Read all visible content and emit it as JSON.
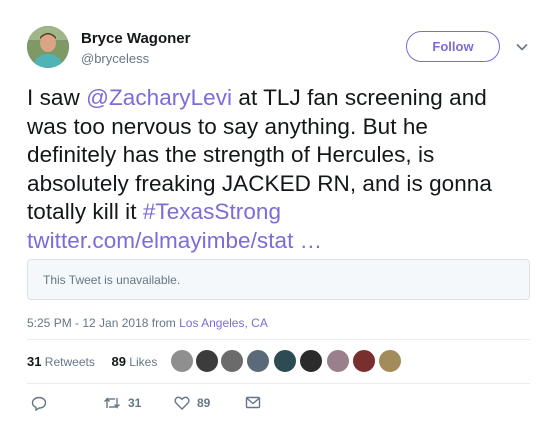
{
  "author": {
    "name": "Bryce Wagoner",
    "handle": "@bryceless"
  },
  "follow_label": "Follow",
  "tweet": {
    "lines": [
      [
        {
          "t": "I saw "
        },
        {
          "t": "@ZacharyLevi",
          "link": true
        },
        {
          "t": " at TLJ fan screening and"
        }
      ],
      [
        {
          "t": "was too nervous to say anything. But he"
        }
      ],
      [
        {
          "t": "definitely has the strength of Hercules, is"
        }
      ],
      [
        {
          "t": "absolutely freaking JACKED RN, and is gonna"
        }
      ],
      [
        {
          "t": "totally kill it "
        },
        {
          "t": "#TexasStrong",
          "link": true
        }
      ],
      [
        {
          "t": "twitter.com/elmayimbe/stat …",
          "link": true
        }
      ]
    ]
  },
  "quoted_tweet_text": "This Tweet is unavailable.",
  "timestamp": "5:25 PM - 12 Jan 2018",
  "from_label": " from ",
  "location": "Los Angeles, CA",
  "stats": {
    "retweets_count": "31",
    "retweets_label": " Retweets",
    "likes_count": "89",
    "likes_label": " Likes"
  },
  "actions": {
    "retweet_count": "31",
    "like_count": "89"
  },
  "colors": {
    "accent": "#7b6cd9",
    "muted": "#657786"
  }
}
